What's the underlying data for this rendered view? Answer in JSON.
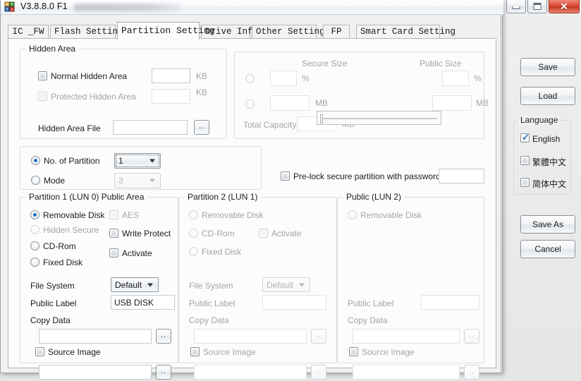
{
  "window": {
    "title": "V3.8.8.0 F1",
    "app_icon": "blocks-icon",
    "minimize_label": "–",
    "maximize_label": "□",
    "close_label": "✕"
  },
  "tabs": [
    {
      "label": "IC _FW",
      "active": false
    },
    {
      "label": "Flash Setting",
      "active": false
    },
    {
      "label": "Partition Setting",
      "active": true
    },
    {
      "label": "Drive Info",
      "active": false
    },
    {
      "label": "Other Setting",
      "active": false
    },
    {
      "label": "FP",
      "active": false
    },
    {
      "label": "Smart Card Setting",
      "active": false
    }
  ],
  "hidden_area": {
    "legend": "Hidden Area",
    "normal_hidden_area": {
      "label": "Normal Hidden Area",
      "checked": false,
      "value": "",
      "unit": "KB"
    },
    "protected_hidden_area": {
      "label": "Protected Hidden Area",
      "checked": false,
      "value": "",
      "unit": "KB",
      "disabled": true
    },
    "hidden_area_file": {
      "label": "Hidden Area File",
      "value": "",
      "browse_label": ".."
    }
  },
  "secure_size": {
    "secure_title": "Secure Size",
    "public_title": "Public Size",
    "percent_unit": "%",
    "mb_unit": "MB",
    "secure_percent_value": "",
    "public_percent_value": "",
    "secure_mb_value": "",
    "public_mb_value": "",
    "total_capacity_label": "Total Capacity",
    "total_capacity_value": "",
    "total_capacity_unit": "MB",
    "slider_position_percent": 0
  },
  "partition_mode": {
    "no_of_partition": {
      "label": "No. of Partition",
      "selected": true,
      "value": "1"
    },
    "mode": {
      "label": "Mode",
      "selected": false,
      "value": "3",
      "disabled": true
    }
  },
  "prelock": {
    "label": "Pre-lock secure partition with password :",
    "checked": false,
    "password_value": ""
  },
  "partition1": {
    "legend": "Partition 1 (LUN 0) Public Area",
    "radios": [
      {
        "label": "Removable Disk",
        "selected": true,
        "disabled": false
      },
      {
        "label": "Hidden Secure",
        "selected": false,
        "disabled": true
      },
      {
        "label": "CD-Rom",
        "selected": false,
        "disabled": false
      },
      {
        "label": "Fixed Disk",
        "selected": false,
        "disabled": false
      }
    ],
    "checks": [
      {
        "label": "AES",
        "checked": false,
        "disabled": true
      },
      {
        "label": "Write Protect",
        "checked": false,
        "disabled": false
      },
      {
        "label": "Activate",
        "checked": false,
        "disabled": false
      }
    ],
    "file_system_label": "File System",
    "file_system_value": "Default",
    "public_label_label": "Public Label",
    "public_label_value": "USB DISK",
    "copy_data_label": "Copy Data",
    "copy_data_value": "",
    "copy_data_browse": "..",
    "source_image_label": "Source Image",
    "source_image_checked": false,
    "source_image_value": "",
    "source_image_browse": ".."
  },
  "partition2": {
    "legend": "Partition 2 (LUN 1)",
    "radios": [
      {
        "label": "Removable Disk",
        "selected": false,
        "disabled": true
      },
      {
        "label": "CD-Rom",
        "selected": false,
        "disabled": true
      },
      {
        "label": "Fixed Disk",
        "selected": false,
        "disabled": true
      }
    ],
    "checks": [
      {
        "label": "Activate",
        "checked": false,
        "disabled": true
      }
    ],
    "file_system_label": "File System",
    "file_system_value": "Default",
    "public_label_label": "Public Label",
    "public_label_value": "",
    "copy_data_label": "Copy Data",
    "copy_data_value": "",
    "copy_data_browse": "..",
    "source_image_label": "Source Image",
    "source_image_checked": false,
    "source_image_value": "",
    "source_image_browse": ".."
  },
  "public_lun2": {
    "legend": "Public (LUN 2)",
    "radios": [
      {
        "label": "Removable Disk",
        "selected": false,
        "disabled": true
      }
    ],
    "public_label_label": "Public Label",
    "public_label_value": "",
    "copy_data_label": "Copy Data",
    "copy_data_value": "",
    "copy_data_browse": "..",
    "source_image_label": "Source Image",
    "source_image_checked": false,
    "source_image_value": "",
    "source_image_browse": ".."
  },
  "sidebar": {
    "save_label": "Save",
    "load_label": "Load",
    "language_legend": "Language",
    "languages": [
      {
        "label": "English",
        "checked": true
      },
      {
        "label": "繁體中文",
        "checked": false
      },
      {
        "label": "简体中文",
        "checked": false
      }
    ],
    "save_as_label": "Save As",
    "cancel_label": "Cancel"
  },
  "colors": {
    "accent_blue": "#1a6fc4",
    "close_red": "#dc4a34",
    "group_border": "#d7dde2",
    "disabled_text": "#a0a5a9"
  }
}
